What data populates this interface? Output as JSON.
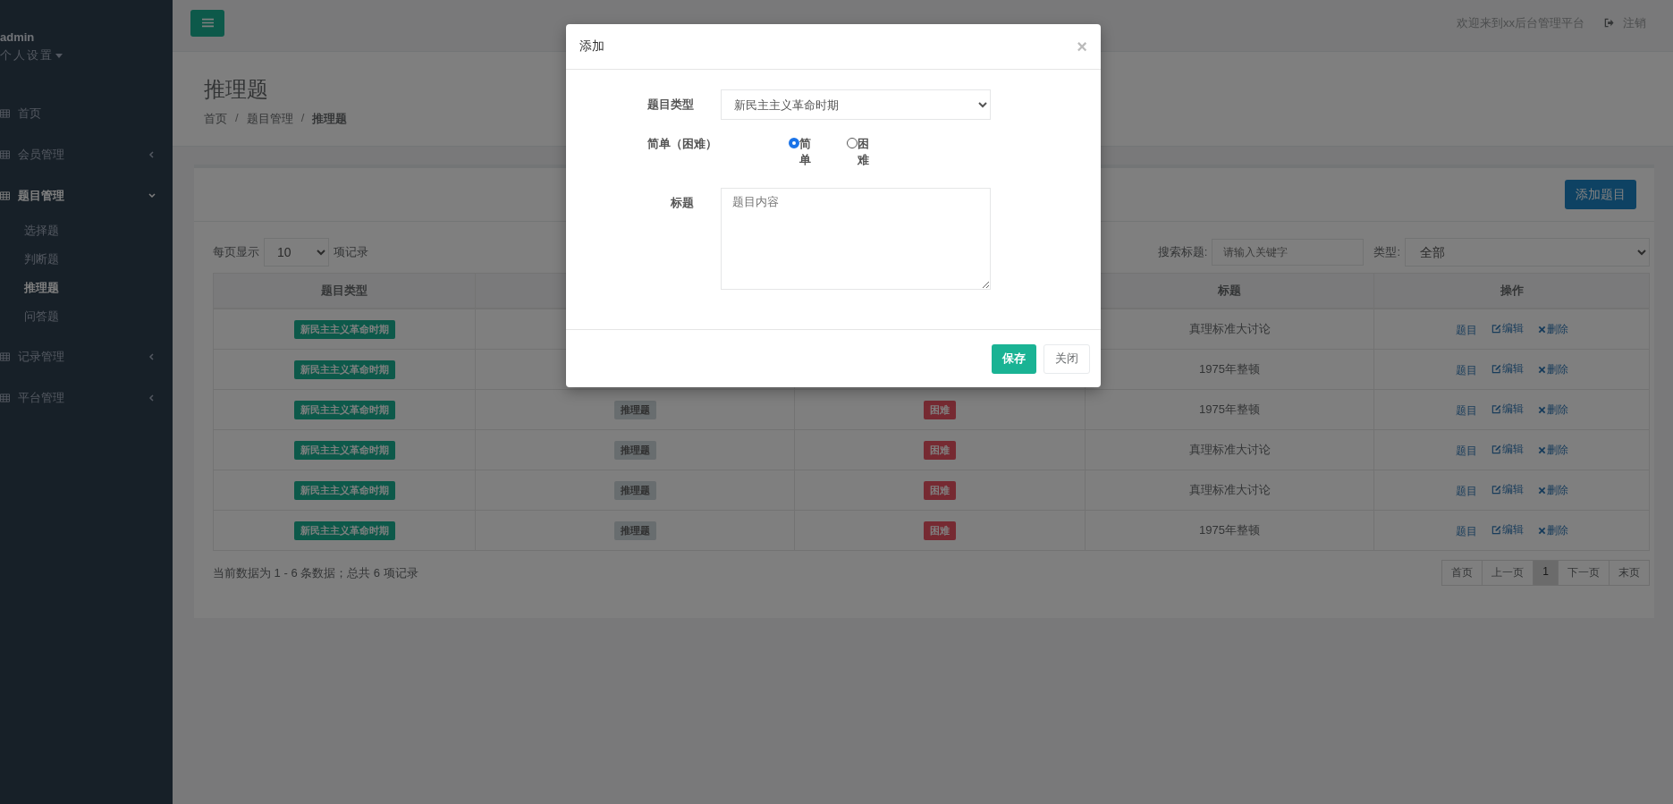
{
  "sidebar": {
    "user": "admin",
    "settings": "个人设置",
    "items": [
      {
        "label": "首页"
      },
      {
        "label": "会员管理",
        "expanded": false
      },
      {
        "label": "题目管理",
        "expanded": true,
        "children": [
          {
            "label": "选择题",
            "selected": false
          },
          {
            "label": "判断题",
            "selected": false
          },
          {
            "label": "推理题",
            "selected": true
          },
          {
            "label": "问答题",
            "selected": false
          }
        ]
      },
      {
        "label": "记录管理",
        "expanded": false
      },
      {
        "label": "平台管理",
        "expanded": false
      }
    ]
  },
  "topbar": {
    "welcome": "欢迎来到xx后台管理平台",
    "logout": "注销"
  },
  "page": {
    "title": "推理题",
    "separator": "/",
    "breadcrumb": [
      {
        "label": "首页",
        "current": false
      },
      {
        "label": "题目管理",
        "current": false
      },
      {
        "label": "推理题",
        "current": true
      }
    ]
  },
  "panel": {
    "add_button": "添加题目",
    "page_size": {
      "prefix": "每页显示",
      "value": "10",
      "suffix": "项记录"
    },
    "search": {
      "label": "搜索标题:",
      "placeholder": "请输入关键字"
    },
    "type_filter": {
      "label": "类型:",
      "value": "全部"
    },
    "table": {
      "columns": [
        {
          "label": "题目类型"
        },
        {},
        {},
        {
          "label": "标题"
        },
        {
          "label": "操作"
        }
      ],
      "rows": [
        {
          "type": "新民主主义革命时期",
          "title": "真理标准大讨论",
          "actions": [
            {
              "kind": "view",
              "label": "题目"
            },
            {
              "kind": "edit",
              "label": "编辑"
            },
            {
              "kind": "delete",
              "label": "删除"
            }
          ]
        },
        {
          "type": "新民主主义革命时期",
          "title": "1975年整顿",
          "actions": [
            {
              "kind": "view",
              "label": "题目"
            },
            {
              "kind": "edit",
              "label": "编辑"
            },
            {
              "kind": "delete",
              "label": "删除"
            }
          ]
        },
        {
          "type": "新民主主义革命时期",
          "column_2": "推理题",
          "column_3": "困难",
          "title": "1975年整顿",
          "actions": [
            {
              "kind": "view",
              "label": "题目"
            },
            {
              "kind": "edit",
              "label": "编辑"
            },
            {
              "kind": "delete",
              "label": "删除"
            }
          ]
        },
        {
          "type": "新民主主义革命时期",
          "column_2": "推理题",
          "column_3": "困难",
          "title": "真理标准大讨论",
          "actions": [
            {
              "kind": "view",
              "label": "题目"
            },
            {
              "kind": "edit",
              "label": "编辑"
            },
            {
              "kind": "delete",
              "label": "删除"
            }
          ]
        },
        {
          "type": "新民主主义革命时期",
          "column_2": "推理题",
          "column_3": "困难",
          "title": "真理标准大讨论",
          "actions": [
            {
              "kind": "view",
              "label": "题目"
            },
            {
              "kind": "edit",
              "label": "编辑"
            },
            {
              "kind": "delete",
              "label": "删除"
            }
          ]
        },
        {
          "type": "新民主主义革命时期",
          "column_2": "推理题",
          "column_3": "困难",
          "title": "1975年整顿",
          "actions": [
            {
              "kind": "view",
              "label": "题目"
            },
            {
              "kind": "edit",
              "label": "编辑"
            },
            {
              "kind": "delete",
              "label": "删除"
            }
          ]
        }
      ]
    },
    "info": "当前数据为 1 - 6 条数据；总共 6 项记录",
    "pagination": [
      {
        "label": "首页",
        "selected": false
      },
      {
        "label": "上一页",
        "selected": false
      },
      {
        "label": "1",
        "selected": true
      },
      {
        "label": "下一页",
        "selected": false
      },
      {
        "label": "末页",
        "selected": false
      }
    ]
  },
  "modal": {
    "title": "添加",
    "close": "×",
    "type_field": {
      "label": "题目类型",
      "value": "新民主主义革命时期"
    },
    "difficulty": {
      "label": "简单（困难）",
      "options": [
        {
          "label": "简单",
          "selected": true
        },
        {
          "label": "困难",
          "selected": false
        }
      ]
    },
    "title_field": {
      "label": "标题",
      "placeholder": "题目内容"
    },
    "buttons": [
      {
        "kind": "primary",
        "label": "保存"
      },
      {
        "kind": "default",
        "label": "关闭"
      }
    ]
  }
}
